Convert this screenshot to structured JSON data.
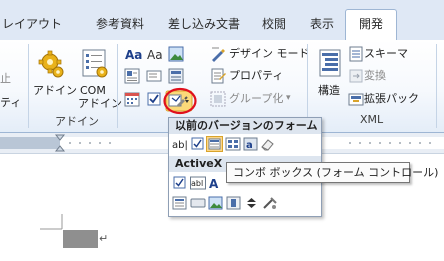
{
  "tabs": [
    {
      "label": "レイアウト"
    },
    {
      "label": "参考資料"
    },
    {
      "label": "差し込み文書"
    },
    {
      "label": "校閲"
    },
    {
      "label": "表示"
    },
    {
      "label": "開発"
    }
  ],
  "ribbon": {
    "partial_left": {
      "line1": "止",
      "line2": "ティ"
    },
    "addin_group": {
      "label": "アドイン",
      "addin_button": "アドイン",
      "com_addin_button": {
        "line1": "COM",
        "line2": "アドイン"
      }
    },
    "controls_group": {
      "design_mode": "デザイン モード",
      "properties": "プロパティ",
      "grouping": "グループ化"
    },
    "xml_group": {
      "label": "XML",
      "structure": "構造",
      "schema": "スキーマ",
      "transform": "変換",
      "expansion_pack": "拡張パック"
    }
  },
  "dropdown": {
    "legacy_forms_heading": "以前のバージョンのフォーム",
    "activex_heading": "ActiveX"
  },
  "tooltip": {
    "text": "コンボ ボックス (フォーム コントロール)"
  },
  "document": {
    "paragraph_mark": "↵"
  },
  "colors": {
    "highlight_circle": "#e0101c",
    "active_tab_border": "#9eb6d4",
    "ribbon_bg": "#e4edf8"
  }
}
